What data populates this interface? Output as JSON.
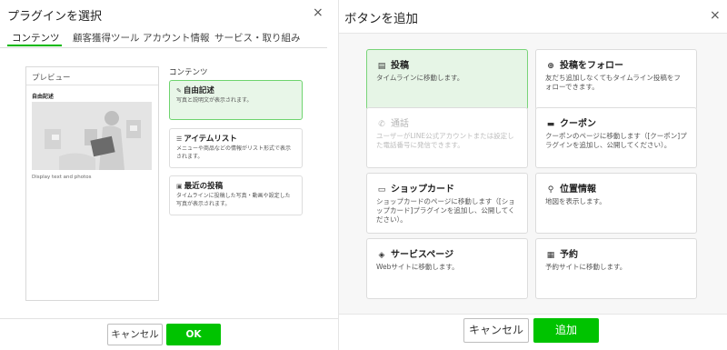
{
  "left_dialog": {
    "title": "プラグインを選択",
    "close": "×",
    "tabs": [
      {
        "label": "コンテンツ",
        "active": true
      },
      {
        "label": "顧客獲得ツール",
        "active": false
      },
      {
        "label": "アカウント情報",
        "active": false
      },
      {
        "label": "サービス・取り組み",
        "active": false
      }
    ],
    "preview": {
      "title": "プレビュー",
      "item_name": "自由記述",
      "description": "Display text and photos"
    },
    "content_label": "コンテンツ",
    "plugins": [
      {
        "title": "自由記述",
        "icon": "edit-icon",
        "glyph": "✎",
        "description": "写真と説明文が表示されます。",
        "selected": true
      },
      {
        "title": "アイテムリスト",
        "icon": "list-icon",
        "glyph": "☰",
        "description": "メニューや商品などの情報がリスト形式で表示されます。",
        "selected": false
      },
      {
        "title": "最近の投稿",
        "icon": "photos-icon",
        "glyph": "▣",
        "description": "タイムラインに投稿した写真・動画や設定した写真が表示されます。",
        "selected": false
      }
    ],
    "cancel_label": "キャンセル",
    "ok_label": "OK",
    "accent": "#00c300"
  },
  "right_dialog": {
    "title": "ボタンを追加",
    "close": "×",
    "buttons": [
      {
        "title": "投稿",
        "icon": "post-icon",
        "glyph": "▤",
        "description": "タイムラインに移動します。",
        "selected": true,
        "disabled": false
      },
      {
        "title": "投稿をフォロー",
        "icon": "plus-square-icon",
        "glyph": "⊕",
        "description": "友だち追加しなくてもタイムライン投稿をフォローできます。",
        "selected": false,
        "disabled": false
      },
      {
        "title": "通話",
        "icon": "phone-icon",
        "glyph": "✆",
        "description": "ユーザーがLINE公式アカウントまたは設定した電話番号に発信できます。",
        "selected": false,
        "disabled": true
      },
      {
        "title": "クーポン",
        "icon": "coupon-icon",
        "glyph": "▬",
        "description": "クーポンのページに移動します（[クーポン]プラグインを追加し、公開してください）。",
        "selected": false,
        "disabled": false
      },
      {
        "title": "ショップカード",
        "icon": "shop-card-icon",
        "glyph": "▭",
        "description": "ショップカードのページに移動します（[ショップカード]プラグインを追加し、公開してください）。",
        "selected": false,
        "disabled": false
      },
      {
        "title": "位置情報",
        "icon": "location-pin-icon",
        "glyph": "⚲",
        "description": "地図を表示します。",
        "selected": false,
        "disabled": false
      },
      {
        "title": "サービスページ",
        "icon": "tag-icon",
        "glyph": "◈",
        "description": "Webサイトに移動します。",
        "selected": false,
        "disabled": false
      },
      {
        "title": "予約",
        "icon": "calendar-icon",
        "glyph": "▦",
        "description": "予約サイトに移動します。",
        "selected": false,
        "disabled": false
      }
    ],
    "cancel_label": "キャンセル",
    "add_label": "追加"
  }
}
